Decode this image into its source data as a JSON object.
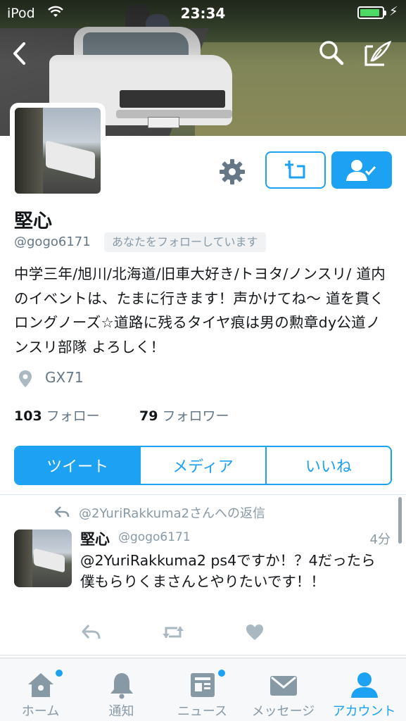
{
  "status_bar": {
    "carrier": "iPod",
    "time": "23:34",
    "battery_percent": 90
  },
  "profile": {
    "name": "堅心",
    "handle": "@gogo6171",
    "follows_you": "あなたをフォローしています",
    "bio": "中学三年/旭川/北海道/旧車大好き/トヨタ/ノンスリ/ 道内のイベントは、たまに行きます！声かけてね〜 道を貫くロングノーズ☆道路に残るタイヤ痕は男の勲章dy公道ノンスリ部隊 よろしく！",
    "location": "GX71",
    "following_count": "103",
    "following_label": "フォロー",
    "followers_count": "79",
    "followers_label": "フォロワー"
  },
  "tabs": [
    {
      "label": "ツイート",
      "active": true
    },
    {
      "label": "メディア",
      "active": false
    },
    {
      "label": "いいね",
      "active": false
    }
  ],
  "tweet": {
    "reply_context": "@2YuriRakkuma2さんへの返信",
    "name": "堅心",
    "handle": "@gogo6171",
    "time": "4分",
    "text": "@2YuriRakkuma2 ps4ですか！？4だったら僕もらりくまさんとやりたいです！！"
  },
  "tabbar": [
    {
      "label": "ホーム",
      "icon": "home-icon",
      "badge": true,
      "active": false
    },
    {
      "label": "通知",
      "icon": "bell-icon",
      "badge": false,
      "active": false
    },
    {
      "label": "ニュース",
      "icon": "news-icon",
      "badge": true,
      "active": false
    },
    {
      "label": "メッセージ",
      "icon": "envelope-icon",
      "badge": false,
      "active": false
    },
    {
      "label": "アカウント",
      "icon": "person-icon",
      "badge": false,
      "active": true
    }
  ],
  "colors": {
    "accent": "#1da1f2",
    "text": "#14171a",
    "muted": "#657786"
  }
}
